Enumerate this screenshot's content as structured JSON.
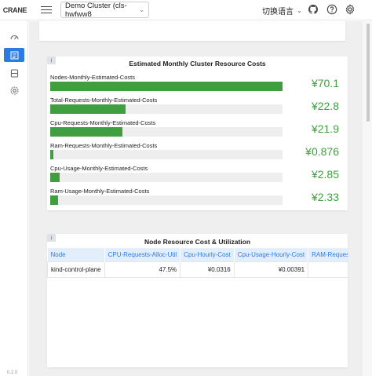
{
  "header": {
    "logo_text": "CRANE",
    "cluster_selected": "Demo Cluster (cls-hwfww8",
    "language_label": "切换语言",
    "icons": [
      "menu-icon",
      "github-icon",
      "help-icon",
      "settings-icon"
    ]
  },
  "sidebar": {
    "items": [
      {
        "icon": "dashboard-gauge-icon",
        "active": false
      },
      {
        "icon": "cost-report-icon",
        "active": true
      },
      {
        "icon": "server-icon",
        "active": false
      },
      {
        "icon": "settings-gear-icon",
        "active": false
      }
    ],
    "version": "0.2.0"
  },
  "cost_panel": {
    "title": "Estimated Monthly Cluster Resource Costs",
    "info": "i",
    "rows": [
      {
        "label": "Nodes-Monthly-Estimated-Costs",
        "value": "¥70.1",
        "fraction": 1.0
      },
      {
        "label": "Total-Requests-Monthly-Estimated-Costs",
        "value": "¥22.8",
        "fraction": 0.325
      },
      {
        "label": "Cpu-Requests-Monthly-Estimated-Costs",
        "value": "¥21.9",
        "fraction": 0.312
      },
      {
        "label": "Ram-Requests-Monthly-Estimated-Costs",
        "value": "¥0.876",
        "fraction": 0.0125
      },
      {
        "label": "Cpu-Usage-Monthly-Estimated-Costs",
        "value": "¥2.85",
        "fraction": 0.041
      },
      {
        "label": "Ram-Usage-Monthly-Estimated-Costs",
        "value": "¥2.33",
        "fraction": 0.033
      }
    ]
  },
  "node_panel": {
    "title": "Node Resource Cost & Utilization",
    "info": "i",
    "columns": [
      "Node",
      "CPU-Requests-Alloc-Util",
      "Cpu-Hourly-Cost",
      "Cpu-Usage-Hourly-Cost",
      "RAM-Requests"
    ],
    "rows": [
      [
        "kind-control-plane",
        "47.5%",
        "¥0.0316",
        "¥0.00391",
        ""
      ]
    ]
  },
  "colors": {
    "accent": "#2c7be5",
    "bar_green": "#3f9f3f",
    "background": "#efefef"
  }
}
